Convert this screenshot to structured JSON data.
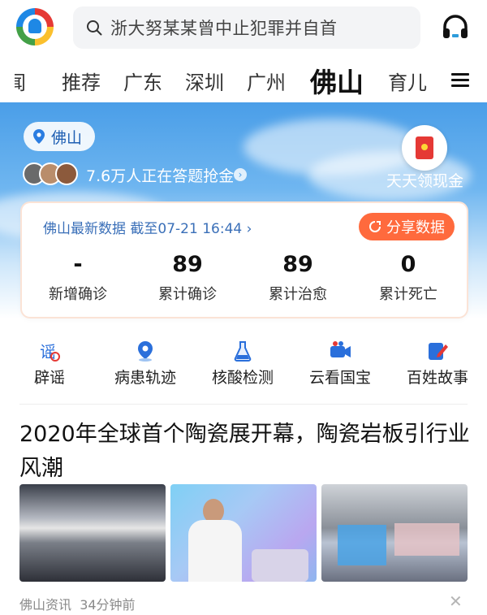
{
  "search": {
    "text": "浙大努某某曾中止犯罪并自首"
  },
  "tabs": [
    {
      "label": "闻"
    },
    {
      "label": "推荐"
    },
    {
      "label": "广东"
    },
    {
      "label": "深圳"
    },
    {
      "label": "广州"
    },
    {
      "label": "佛山"
    },
    {
      "label": "育儿"
    }
  ],
  "hero": {
    "location": "佛山",
    "quiz_text": "7.6万人正在答题抢金",
    "cash_text": "天天领现金"
  },
  "card": {
    "title": "佛山最新数据  截至07-21 16:44 ›",
    "share_label": "分享数据",
    "stats": [
      {
        "value": "-",
        "label": "新增确诊"
      },
      {
        "value": "89",
        "label": "累计确诊"
      },
      {
        "value": "89",
        "label": "累计治愈"
      },
      {
        "value": "0",
        "label": "累计死亡"
      }
    ]
  },
  "quick_links": [
    {
      "label": "辟谣",
      "icon": "rumor-icon"
    },
    {
      "label": "病患轨迹",
      "icon": "location-pin-icon"
    },
    {
      "label": "核酸检测",
      "icon": "flask-icon"
    },
    {
      "label": "云看国宝",
      "icon": "video-camera-icon"
    },
    {
      "label": "百姓故事",
      "icon": "edit-icon"
    }
  ],
  "article": {
    "headline": "2020年全球首个陶瓷展开幕，陶瓷岩板引行业风潮",
    "source": "佛山资讯",
    "time": "34分钟前"
  },
  "colors": {
    "accent_blue": "#4a9ee8",
    "share_orange": "#ff6a3d",
    "title_blue": "#3a6fb8"
  }
}
